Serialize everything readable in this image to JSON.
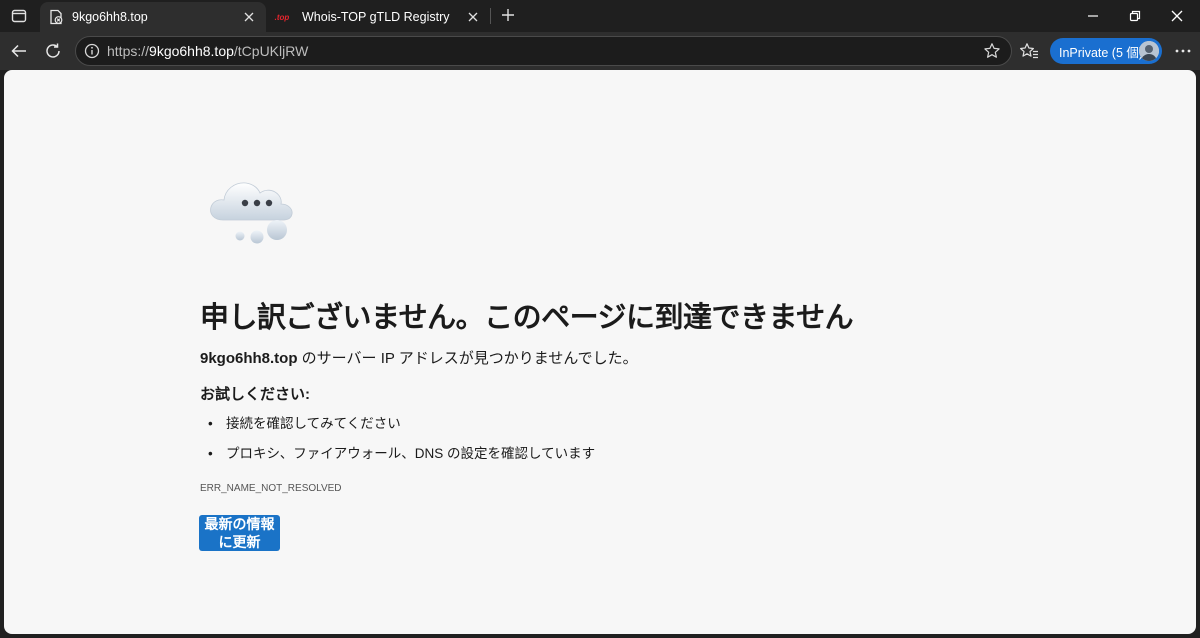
{
  "tabs": [
    {
      "title": "9kgo6hh8.top",
      "favicon": "site-error-icon",
      "active": true
    },
    {
      "title": "Whois-TOP gTLD Registry",
      "favicon": ".top",
      "active": false
    }
  ],
  "address_bar": {
    "url_prefix": "https://",
    "url_host": "9kgo6hh8.top",
    "url_path": "/tCpUKljRW"
  },
  "profile": {
    "label": "InPrivate (5 個)"
  },
  "error": {
    "heading": "申し訳ございません。このページに到達できません",
    "host": "9kgo6hh8.top",
    "message": " のサーバー IP アドレスが見つかりませんでした。",
    "try_heading": "お試しください:",
    "suggestions": [
      "接続を確認してみてください",
      "プロキシ、ファイアウォール、DNS の設定を確認しています"
    ],
    "code": "ERR_NAME_NOT_RESOLVED",
    "refresh_line1": "最新の情報",
    "refresh_line2": "に更新"
  },
  "colors": {
    "accent": "#1a73c7",
    "inprivate": "#1a6fd0",
    "page_bg": "#f7f7f7",
    "chrome_bg": "#1f1f1f"
  }
}
